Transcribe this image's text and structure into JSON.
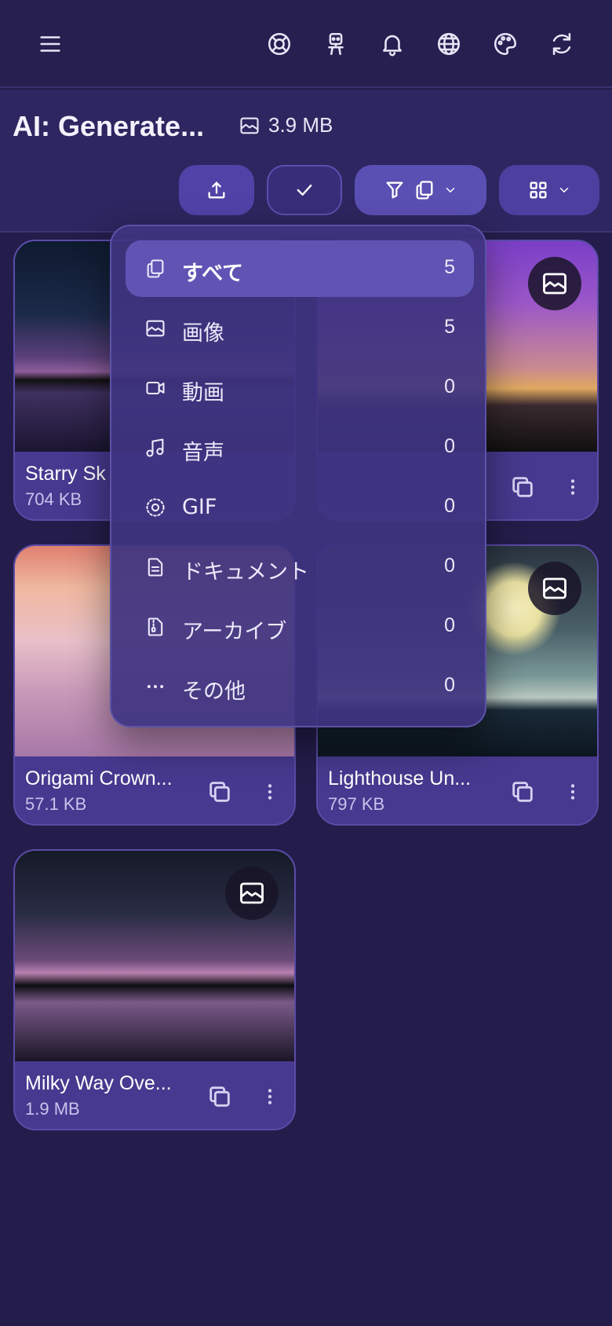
{
  "header": {
    "title": "AI: Generate...",
    "size": "3.9 MB"
  },
  "filter_menu": {
    "items": [
      {
        "label": "すべて",
        "count": "5",
        "icon": "copy-icon"
      },
      {
        "label": "画像",
        "count": "5",
        "icon": "image-icon"
      },
      {
        "label": "動画",
        "count": "0",
        "icon": "video-icon"
      },
      {
        "label": "音声",
        "count": "0",
        "icon": "music-icon"
      },
      {
        "label": "GIF",
        "count": "0",
        "icon": "gif-icon"
      },
      {
        "label": "ドキュメント",
        "count": "0",
        "icon": "document-icon"
      },
      {
        "label": "アーカイブ",
        "count": "0",
        "icon": "archive-icon"
      },
      {
        "label": "その他",
        "count": "0",
        "icon": "more-horizontal-icon"
      }
    ]
  },
  "files": [
    {
      "name": "Starry Sk",
      "size": "704 KB"
    },
    {
      "name": "",
      "size": ""
    },
    {
      "name": "Origami Crown...",
      "size": "57.1 KB"
    },
    {
      "name": "Lighthouse Un...",
      "size": "797 KB"
    },
    {
      "name": "Milky Way Ove...",
      "size": "1.9 MB"
    }
  ],
  "colors": {
    "background": "#241d4b",
    "accent": "#5a4fb3",
    "card": "#47398f"
  }
}
